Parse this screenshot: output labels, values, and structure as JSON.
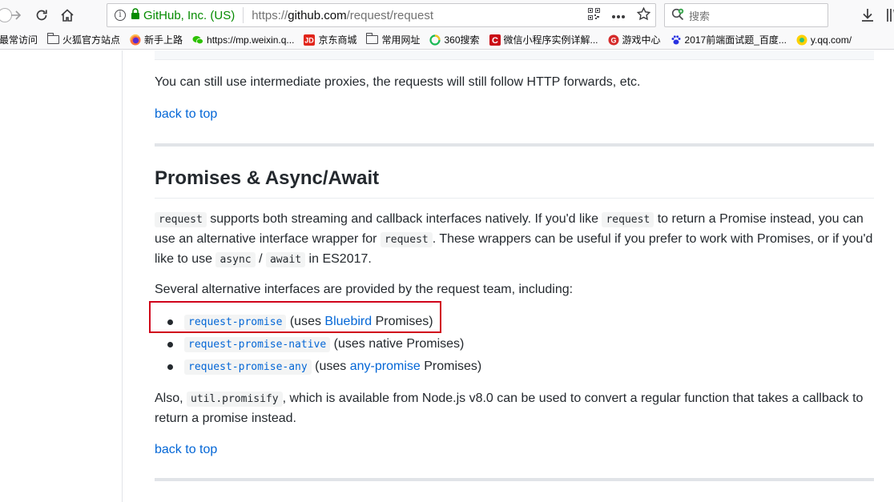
{
  "browser": {
    "identity": "GitHub, Inc. (US)",
    "url_prefix": "https://",
    "url_host": "github.com",
    "url_path": "/request/request",
    "search_placeholder": "搜索",
    "bookmarks": [
      {
        "label": "最常访问",
        "icon": "folder-icon"
      },
      {
        "label": "火狐官方站点",
        "icon": "folder-icon"
      },
      {
        "label": "新手上路",
        "icon": "firefox-icon"
      },
      {
        "label": "https://mp.weixin.q...",
        "icon": "wechat-icon"
      },
      {
        "label": "京东商城",
        "icon": "jd-icon"
      },
      {
        "label": "常用网址",
        "icon": "folder-icon"
      },
      {
        "label": "360搜索",
        "icon": "360-icon"
      },
      {
        "label": "微信小程序实例详解...",
        "icon": "csdn-icon"
      },
      {
        "label": "游戏中心",
        "icon": "game-icon"
      },
      {
        "label": "2017前端面试题_百度...",
        "icon": "baidu-icon"
      },
      {
        "label": "y.qq.com/",
        "icon": "qqmusic-icon"
      }
    ]
  },
  "content": {
    "intro_text": "You can still use intermediate proxies, the requests will still follow HTTP forwards, etc.",
    "back_to_top": "back to top",
    "heading": "Promises & Async/Await",
    "para1": {
      "code1": "request",
      "t1": " supports both streaming and callback interfaces natively. If you'd like ",
      "code2": "request",
      "t2": " to return a Promise instead, you can use an alternative interface wrapper for ",
      "code3": "request",
      "t3": ". These wrappers can be useful if you prefer to work with Promises, or if you'd like to use ",
      "code4": "async",
      "t4": " / ",
      "code5": "await",
      "t5": " in ES2017."
    },
    "para2": "Several alternative interfaces are provided by the request team, including:",
    "list": [
      {
        "code": "request-promise",
        "pre": " (uses ",
        "link": "Bluebird",
        "post": " Promises)"
      },
      {
        "code": "request-promise-native",
        "pre": " (uses native Promises)",
        "link": "",
        "post": ""
      },
      {
        "code": "request-promise-any",
        "pre": " (uses ",
        "link": "any-promise",
        "post": " Promises)"
      }
    ],
    "para3": {
      "t1": "Also, ",
      "code": "util.promisify",
      "t2": ", which is available from Node.js v8.0 can be used to convert a regular function that takes a callback to return a promise instead."
    },
    "back_to_top_2": "back to top"
  },
  "colors": {
    "link": "#0366d6",
    "highlight": "#d0021b",
    "identity_green": "#058b00"
  }
}
